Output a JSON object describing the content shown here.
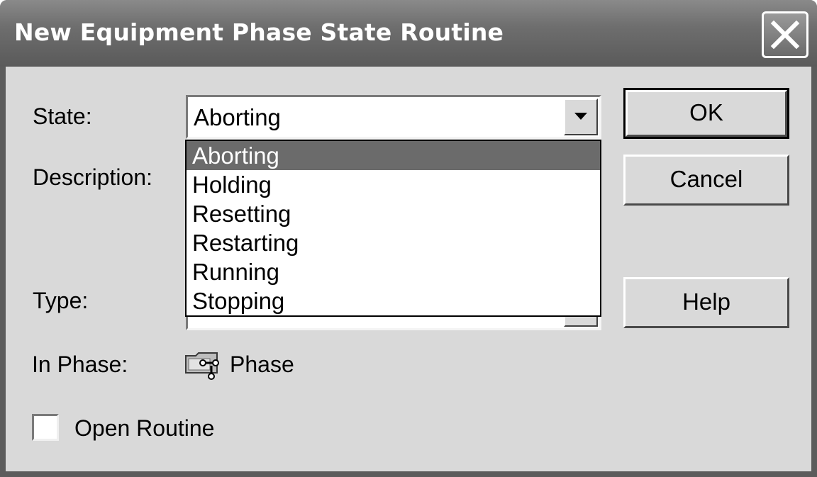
{
  "window": {
    "title": "New Equipment Phase State Routine"
  },
  "form": {
    "state_label": "State:",
    "state_value": "Aborting",
    "description_label": "Description:",
    "type_label": "Type:",
    "in_phase_label": "In Phase:",
    "in_phase_value": "Phase",
    "open_routine_label": "Open Routine",
    "open_routine_checked": false
  },
  "dropdown": {
    "options": [
      "Aborting",
      "Holding",
      "Resetting",
      "Restarting",
      "Running",
      "Stopping"
    ],
    "selected": "Aborting"
  },
  "buttons": {
    "ok": "OK",
    "cancel": "Cancel",
    "help": "Help"
  },
  "icons": {
    "close": "close-icon",
    "dropdown_arrow": "chevron-down-icon",
    "phase": "phase-icon"
  },
  "colors": {
    "title_bar": "#6e6e6e",
    "dialog_face": "#d9d9d9",
    "selection": "#6b6b6b"
  }
}
